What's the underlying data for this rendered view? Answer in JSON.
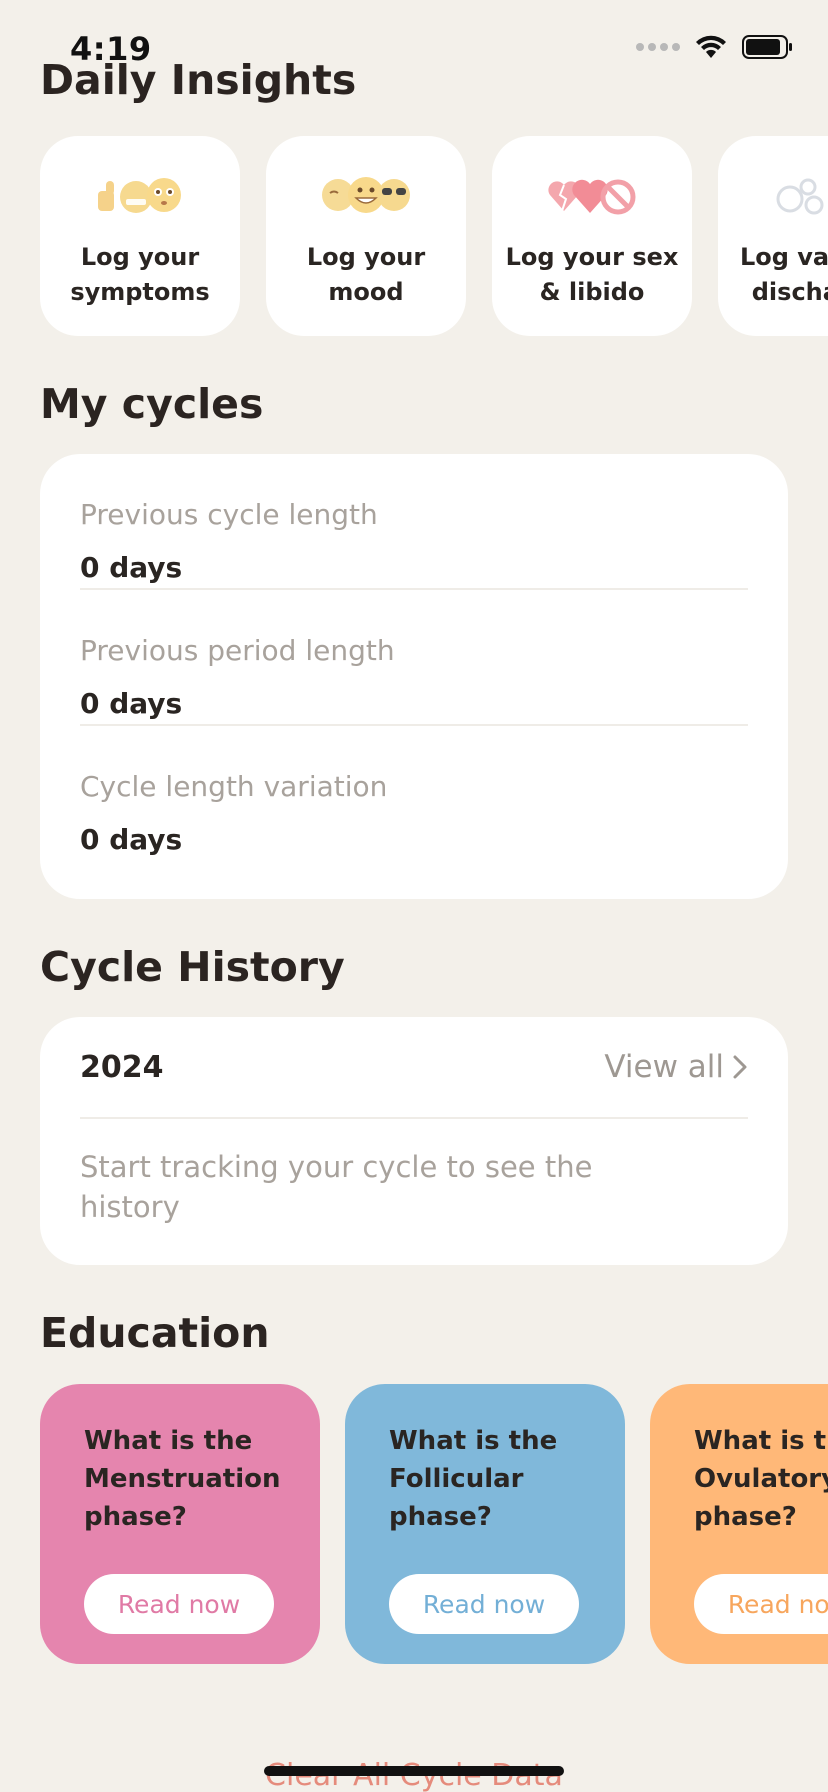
{
  "status_bar": {
    "time": "4:19"
  },
  "sections": {
    "daily_insights": "Daily Insights",
    "my_cycles": "My cycles",
    "cycle_history": "Cycle History",
    "education": "Education"
  },
  "insights": [
    {
      "label": "Log your symptoms",
      "icons": [
        "thumbs-up-icon",
        "grimace-face-icon",
        "flushed-face-icon"
      ]
    },
    {
      "label": "Log your mood",
      "icons": [
        "relieved-face-icon",
        "grinning-face-icon",
        "sunglasses-face-icon"
      ]
    },
    {
      "label": "Log your sex & libido",
      "icons": [
        "broken-heart-icon",
        "heart-icon",
        "prohibited-icon"
      ]
    },
    {
      "label": "Log vaginal discharge",
      "icons": [
        "bubbles-icon",
        "drop-icon"
      ]
    }
  ],
  "cycles": [
    {
      "label": "Previous cycle length",
      "value": "0 days"
    },
    {
      "label": "Previous period length",
      "value": "0 days"
    },
    {
      "label": "Cycle length variation",
      "value": "0 days"
    }
  ],
  "history": {
    "year": "2024",
    "view_all": "View all",
    "empty_text": "Start tracking your cycle to see the history"
  },
  "education": [
    {
      "title": "What is the Menstruation phase?",
      "button": "Read now",
      "color": "#e585ae"
    },
    {
      "title": "What is the Follicular phase?",
      "button": "Read now",
      "color": "#80b8da"
    },
    {
      "title": "What is the Ovulatory phase?",
      "button": "Read now",
      "color": "#ffb878"
    }
  ],
  "footer": {
    "clear_label": "Clear All Cycle Data"
  }
}
